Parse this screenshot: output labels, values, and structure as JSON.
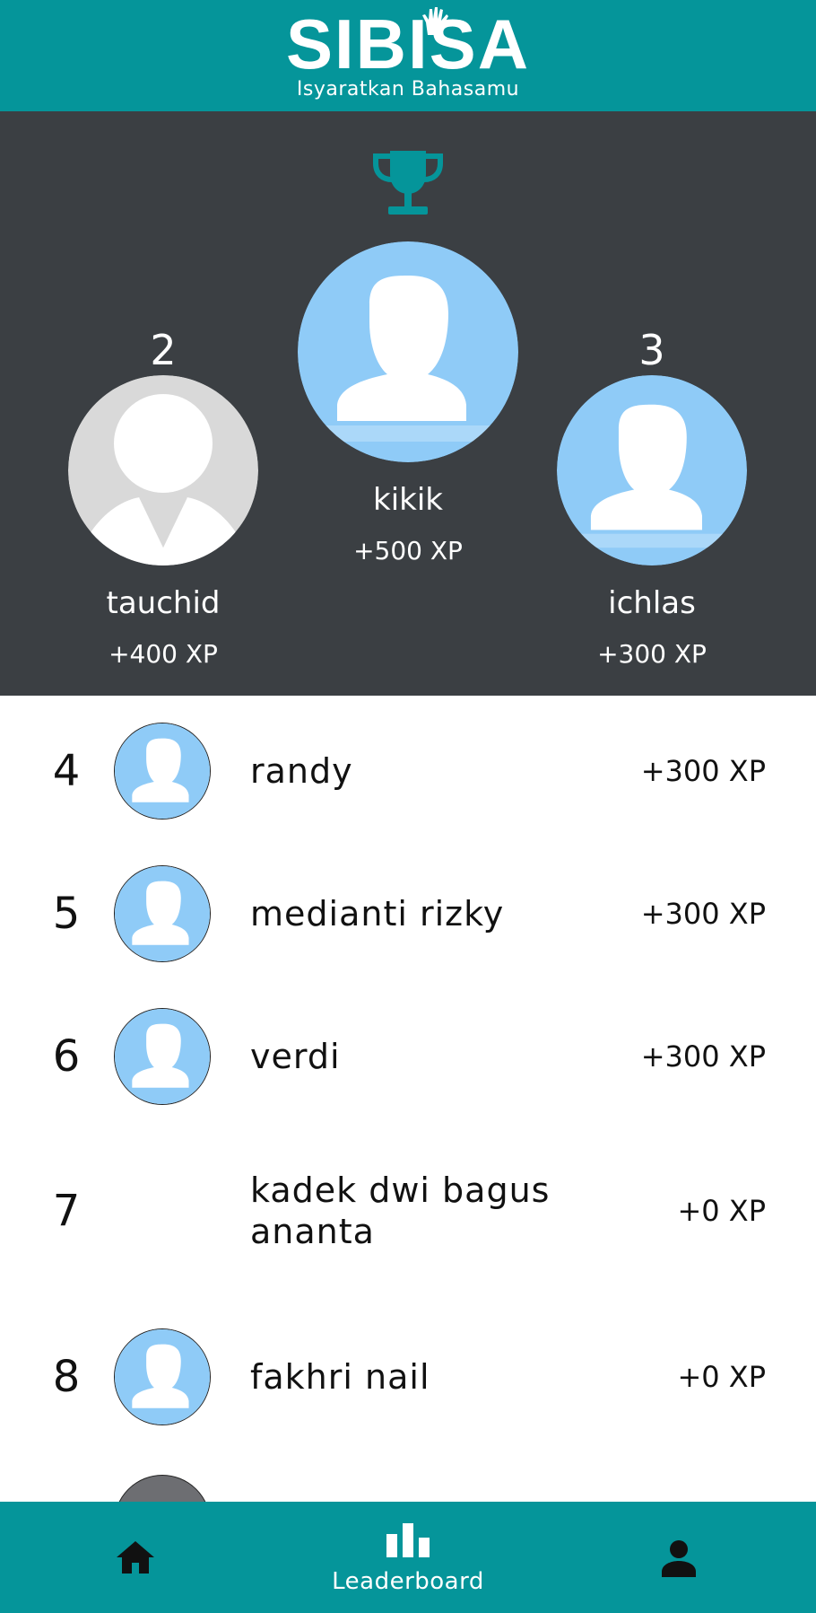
{
  "app": {
    "logo_text": "SIBISA",
    "tagline": "Isyaratkan Bahasamu"
  },
  "podium": {
    "first": {
      "rank": "1",
      "name": "kikik",
      "xp": "+500 XP",
      "avatar": "blue"
    },
    "second": {
      "rank": "2",
      "name": "tauchid",
      "xp": "+400 XP",
      "avatar": "gray"
    },
    "third": {
      "rank": "3",
      "name": "ichlas",
      "xp": "+300 XP",
      "avatar": "blue"
    }
  },
  "leaderboard": [
    {
      "rank": "4",
      "name": "randy",
      "xp": "+300 XP",
      "avatar": "blue"
    },
    {
      "rank": "5",
      "name": "medianti rizky",
      "xp": "+300 XP",
      "avatar": "blue"
    },
    {
      "rank": "6",
      "name": "verdi",
      "xp": "+300 XP",
      "avatar": "blue"
    },
    {
      "rank": "7",
      "name": "kadek dwi bagus ananta",
      "xp": "+0 XP",
      "avatar": "none"
    },
    {
      "rank": "8",
      "name": "fakhri nail",
      "xp": "+0 XP",
      "avatar": "blue"
    }
  ],
  "nav": {
    "home_icon": "home-icon",
    "leaderboard_label": "Leaderboard",
    "leaderboard_icon": "bar-chart-icon",
    "profile_icon": "person-icon"
  },
  "colors": {
    "primary": "#05959a",
    "podium_bg": "#3b3f43",
    "avatar_blue": "#8fcbf7",
    "avatar_gray": "#d9d9d9"
  }
}
